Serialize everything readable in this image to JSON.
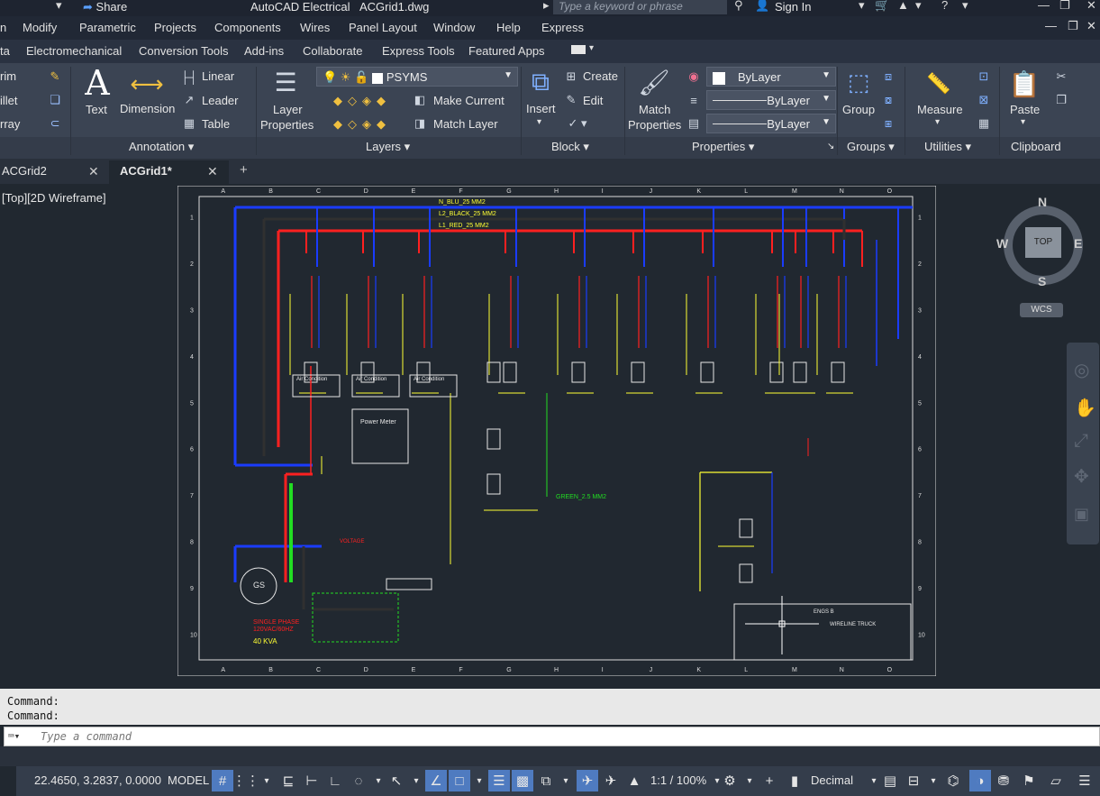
{
  "titlebar": {
    "share": "Share",
    "app": "AutoCAD Electrical",
    "doc": "ACGrid1.dwg",
    "search_placeholder": "Type a keyword or phrase",
    "sign_in": "Sign In"
  },
  "menubar": [
    "n",
    "Modify",
    "Parametric",
    "Projects",
    "Components",
    "Wires",
    "Panel Layout",
    "Window",
    "Help",
    "Express"
  ],
  "ribbon_tabs": [
    "ta",
    "Electromechanical",
    "Conversion Tools",
    "Add-ins",
    "Collaborate",
    "Express Tools",
    "Featured Apps"
  ],
  "ribbon": {
    "modify_items": [
      "rim",
      "illet",
      "rray"
    ],
    "text": "Text",
    "dimension": "Dimension",
    "linear": "Linear",
    "leader": "Leader",
    "table": "Table",
    "annotation_title": "Annotation",
    "layer_properties_1": "Layer",
    "layer_properties_2": "Properties",
    "layer_name": "PSYMS",
    "make_current": "Make Current",
    "match_layer": "Match Layer",
    "layers_title": "Layers",
    "insert": "Insert",
    "create": "Create",
    "edit": "Edit",
    "block_title": "Block",
    "match_properties_1": "Match",
    "match_properties_2": "Properties",
    "bylayer_color": "ByLayer",
    "bylayer_linetype": "ByLayer",
    "bylayer_lineweight": "ByLayer",
    "properties_title": "Properties",
    "group": "Group",
    "groups_title": "Groups",
    "measure": "Measure",
    "utilities_title": "Utilities",
    "paste": "Paste",
    "clipboard_title": "Clipboard"
  },
  "doc_tabs": [
    {
      "label": "ACGrid2"
    },
    {
      "label": "ACGrid1*"
    }
  ],
  "viewport": {
    "label": "[Top][2D Wireframe]",
    "viewcube": {
      "top": "TOP",
      "n": "N",
      "s": "S",
      "e": "E",
      "w": "W",
      "wcs": "WCS"
    }
  },
  "drawing": {
    "col_labels": [
      "A",
      "B",
      "C",
      "D",
      "E",
      "F",
      "G",
      "H",
      "I",
      "J",
      "K",
      "L",
      "M",
      "N",
      "O"
    ],
    "row_labels": [
      "1",
      "2",
      "3",
      "4",
      "5",
      "6",
      "7",
      "8",
      "9",
      "10"
    ],
    "bus_labels": [
      "N_BLU_25 MM2",
      "L2_BLACK_25 MM2",
      "L1_RED_25 MM2"
    ],
    "power_meter": "Power Meter",
    "air_condition": "Air Condition",
    "generator": "GS",
    "single_phase_1": "SINGLE PHASE",
    "single_phase_2": "120VAC/60HZ",
    "kva": "40 KVA",
    "voltage": "VOLTAGE",
    "green_label": "GREEN_2.5 MM2",
    "title_block_1": "ENGS B",
    "title_block_2": "WIRELINE TRUCK"
  },
  "command": {
    "history": [
      "Command:",
      "Command:"
    ],
    "placeholder": "Type a command"
  },
  "status": {
    "coords": "22.4650, 3.2837, 0.0000",
    "model": "MODEL",
    "scale": "1:1 / 100%",
    "units": "Decimal"
  },
  "colors": {
    "ribbon": "#3b4453",
    "viewport": "#212830",
    "wire_red": "#ff2020",
    "wire_blue": "#1a3cff",
    "wire_yellow": "#ffff33",
    "wire_green": "#22dd22"
  }
}
